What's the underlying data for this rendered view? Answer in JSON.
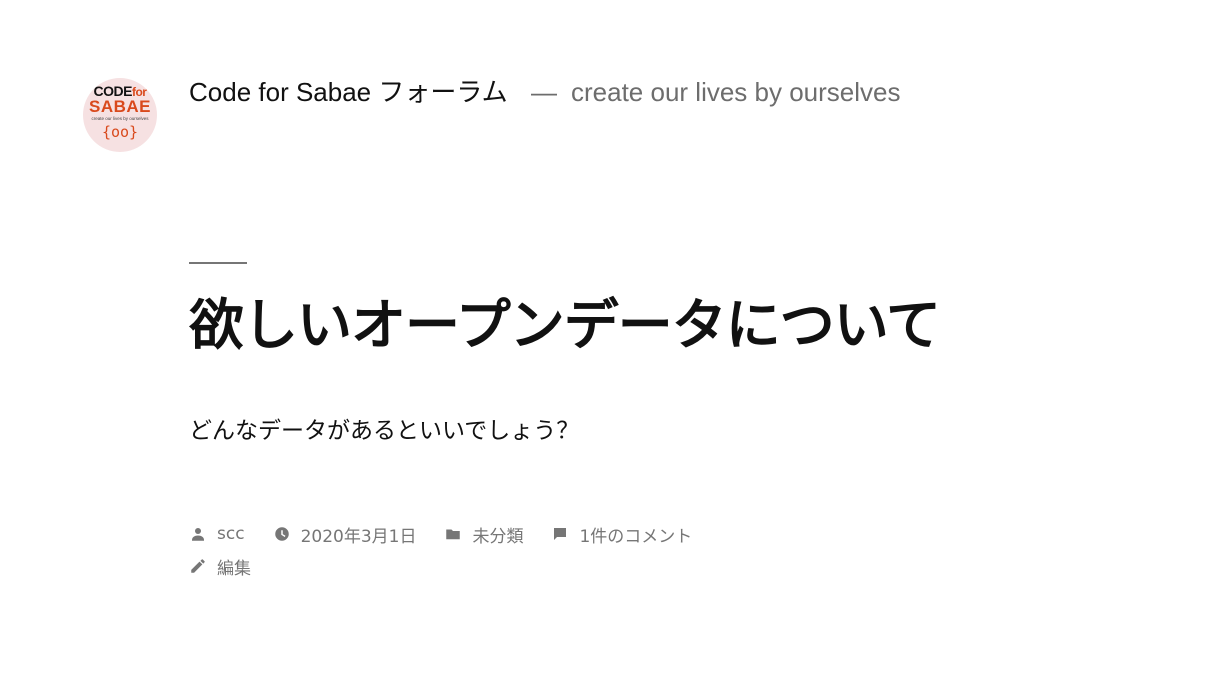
{
  "header": {
    "logo": {
      "line1": "CODE",
      "line1_suffix": "for",
      "line2": "SABAE",
      "line3": "create our lives by ourselves",
      "mark": "{oo}"
    },
    "site_title": "Code for Sabae フォーラム",
    "separator": "—",
    "site_description": "create our lives by ourselves"
  },
  "entry": {
    "title": "欲しいオープンデータについて",
    "content": "どんなデータがあるといいでしょう？"
  },
  "meta": {
    "author": "scc",
    "date": "2020年3月1日",
    "category": "未分類",
    "comments": "1件のコメント",
    "edit": "編集"
  },
  "colors": {
    "text": "#111111",
    "muted": "#767676",
    "brand_accent": "#d9491c",
    "logo_bg": "#f6e1e2"
  },
  "icons": {
    "author": "person-icon",
    "date": "clock-icon",
    "category": "folder-icon",
    "comments": "comment-icon",
    "edit": "pencil-icon"
  }
}
